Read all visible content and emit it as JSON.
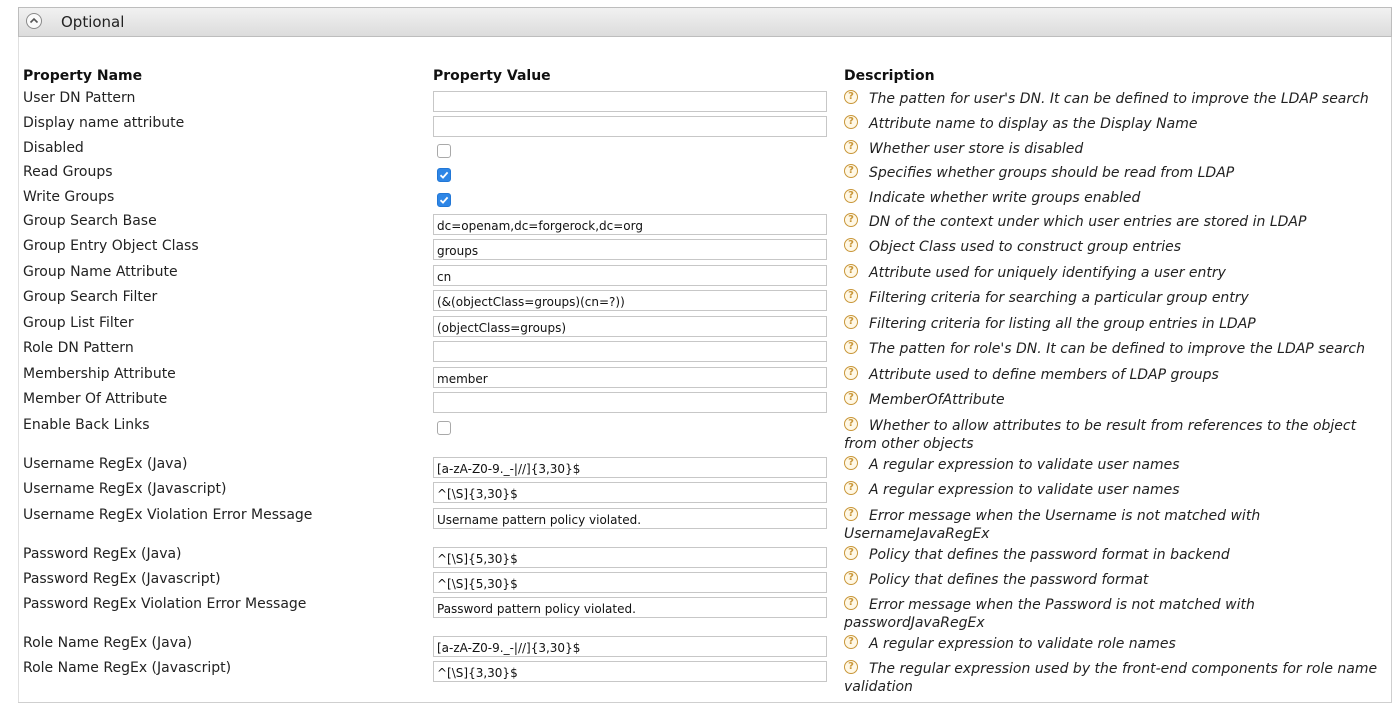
{
  "section": {
    "title": "Optional"
  },
  "columns": {
    "name": "Property Name",
    "value": "Property Value",
    "description": "Description"
  },
  "rows": [
    {
      "name": "User DN Pattern",
      "type": "text",
      "value": "",
      "desc": "The patten for user's DN. It can be defined to improve the LDAP search"
    },
    {
      "name": "Display name attribute",
      "type": "text",
      "value": "",
      "desc": "Attribute name to display as the Display Name"
    },
    {
      "name": "Disabled",
      "type": "checkbox",
      "checked": false,
      "desc": "Whether user store is disabled"
    },
    {
      "name": "Read Groups",
      "type": "checkbox",
      "checked": true,
      "desc": "Specifies whether groups should be read from LDAP"
    },
    {
      "name": "Write Groups",
      "type": "checkbox",
      "checked": true,
      "desc": "Indicate whether write groups enabled"
    },
    {
      "name": "Group Search Base",
      "type": "text",
      "value": "dc=openam,dc=forgerock,dc=org",
      "desc": "DN of the context under which user entries are stored in LDAP"
    },
    {
      "name": "Group Entry Object Class",
      "type": "text",
      "value": "groups",
      "desc": "Object Class used to construct group entries"
    },
    {
      "name": "Group Name Attribute",
      "type": "text",
      "value": "cn",
      "desc": "Attribute used for uniquely identifying a user entry"
    },
    {
      "name": "Group Search Filter",
      "type": "text",
      "value": "(&(objectClass=groups)(cn=?))",
      "desc": "Filtering criteria for searching a particular group entry"
    },
    {
      "name": "Group List Filter",
      "type": "text",
      "value": "(objectClass=groups)",
      "desc": "Filtering criteria for listing all the group entries in LDAP"
    },
    {
      "name": "Role DN Pattern",
      "type": "text",
      "value": "",
      "desc": "The patten for role's DN. It can be defined to improve the LDAP search"
    },
    {
      "name": "Membership Attribute",
      "type": "text",
      "value": "member",
      "desc": "Attribute used to define members of LDAP groups"
    },
    {
      "name": "Member Of Attribute",
      "type": "text",
      "value": "",
      "desc": "MemberOfAttribute"
    },
    {
      "name": "Enable Back Links",
      "type": "checkbox",
      "checked": false,
      "desc": "Whether to allow attributes to be result from references to the object from other objects"
    },
    {
      "name": "Username RegEx (Java)",
      "type": "text",
      "value": "[a-zA-Z0-9._-|//]{3,30}$",
      "desc": "A regular expression to validate user names"
    },
    {
      "name": "Username RegEx (Javascript)",
      "type": "text",
      "value": "^[\\S]{3,30}$",
      "desc": "A regular expression to validate user names"
    },
    {
      "name": "Username RegEx Violation Error Message",
      "type": "text",
      "value": "Username pattern policy violated.",
      "desc": "Error message when the Username is not matched with UsernameJavaRegEx"
    },
    {
      "name": "Password RegEx (Java)",
      "type": "text",
      "value": "^[\\S]{5,30}$",
      "desc": "Policy that defines the password format in backend"
    },
    {
      "name": "Password RegEx (Javascript)",
      "type": "text",
      "value": "^[\\S]{5,30}$",
      "desc": "Policy that defines the password format"
    },
    {
      "name": "Password RegEx Violation Error Message",
      "type": "text",
      "value": "Password pattern policy violated.",
      "desc": "Error message when the Password is not matched with passwordJavaRegEx"
    },
    {
      "name": "Role Name RegEx (Java)",
      "type": "text",
      "value": "[a-zA-Z0-9._-|//]{3,30}$",
      "desc": "A regular expression to validate role names"
    },
    {
      "name": "Role Name RegEx (Javascript)",
      "type": "text",
      "value": "^[\\S]{3,30}$",
      "desc": "The regular expression used by the front-end components for role name validation"
    }
  ]
}
